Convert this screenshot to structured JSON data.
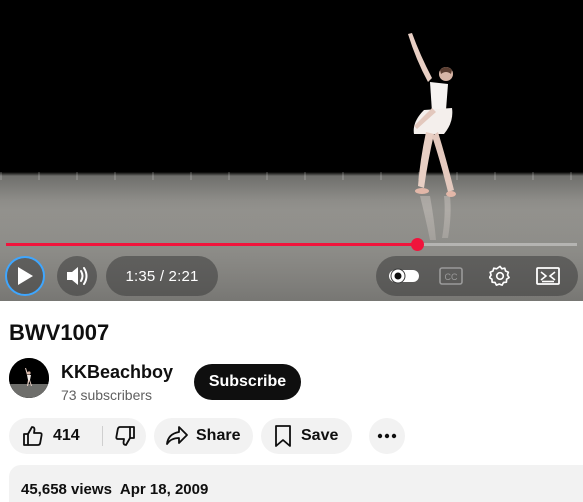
{
  "player": {
    "current_time": "1:35",
    "duration": "2:21",
    "time_display": "1:35 / 2:21",
    "progress_fraction": 0.72,
    "autoplay_on": true,
    "accent_color": "#f0143c",
    "icons": [
      "play-icon",
      "volume-icon",
      "autoplay-toggle-icon",
      "captions-icon",
      "settings-icon",
      "miniplayer-icon"
    ]
  },
  "video": {
    "title": "BWV1007"
  },
  "channel": {
    "name": "KKBeachboy",
    "subscribers": "73 subscribers",
    "subscribe_label": "Subscribe"
  },
  "actions": {
    "like_count": "414",
    "share_label": "Share",
    "save_label": "Save"
  },
  "description": {
    "views": "45,658 views",
    "date": "Apr 18, 2009"
  },
  "captions_label": "CC"
}
